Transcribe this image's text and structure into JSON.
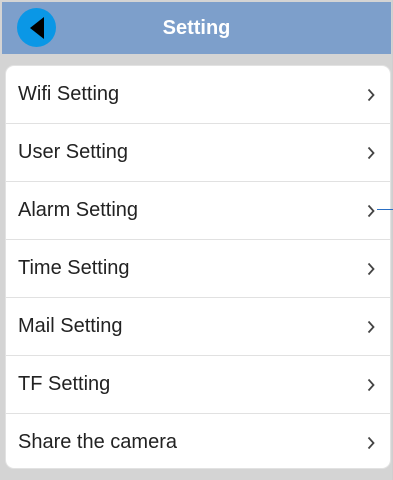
{
  "header": {
    "title": "Setting",
    "background_color": "#7d9fcb",
    "back_icon": "back-arrow-icon",
    "back_button_color": "#0a97e6"
  },
  "menu": {
    "items": [
      {
        "label": "Wifi Setting",
        "icon": "chevron-right-icon"
      },
      {
        "label": "User Setting",
        "icon": "chevron-right-icon"
      },
      {
        "label": "Alarm Setting",
        "icon": "chevron-right-icon"
      },
      {
        "label": "Time Setting",
        "icon": "chevron-right-icon"
      },
      {
        "label": "Mail Setting",
        "icon": "chevron-right-icon"
      },
      {
        "label": "TF Setting",
        "icon": "chevron-right-icon"
      },
      {
        "label": "Share the camera",
        "icon": "chevron-right-icon"
      }
    ]
  }
}
